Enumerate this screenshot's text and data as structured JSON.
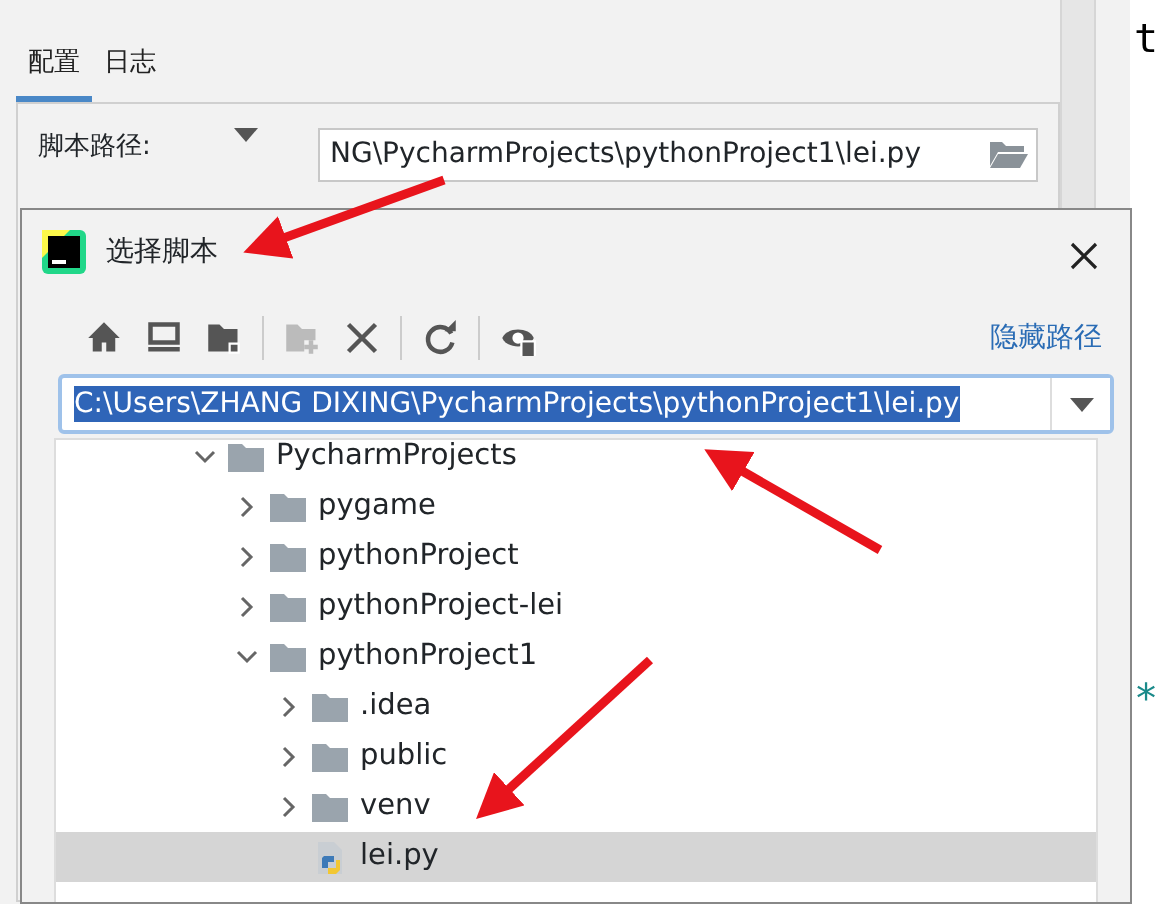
{
  "tabs": [
    {
      "label": "配置",
      "selected": true
    },
    {
      "label": "日志",
      "selected": false
    }
  ],
  "script_path": {
    "label": "脚本路径:",
    "value": "NG\\PycharmProjects\\pythonProject1\\lei.py"
  },
  "editor_fragments": [
    "t",
    "*"
  ],
  "dialog": {
    "title": "选择脚本",
    "toolbar": [
      {
        "kind": "home",
        "disabled": false
      },
      {
        "kind": "desktop",
        "disabled": false
      },
      {
        "kind": "project",
        "disabled": false
      },
      {
        "kind": "new-folder",
        "disabled": true
      },
      {
        "kind": "delete",
        "disabled": false
      },
      {
        "kind": "refresh",
        "disabled": false
      },
      {
        "kind": "hidden",
        "disabled": false
      }
    ],
    "hide_path_link": "隐藏路径",
    "path": "C:\\Users\\ZHANG DIXING\\PycharmProjects\\pythonProject1\\lei.py",
    "tree": [
      {
        "label": "PycharmProjects",
        "kind": "folder",
        "expanded": true,
        "selected": false,
        "children": [
          {
            "label": "pygame",
            "kind": "folder",
            "expanded": false,
            "selected": false
          },
          {
            "label": "pythonProject",
            "kind": "folder",
            "expanded": false,
            "selected": false
          },
          {
            "label": "pythonProject-lei",
            "kind": "folder",
            "expanded": false,
            "selected": false
          },
          {
            "label": "pythonProject1",
            "kind": "folder",
            "expanded": true,
            "selected": false,
            "children": [
              {
                "label": ".idea",
                "kind": "folder",
                "expanded": false,
                "selected": false
              },
              {
                "label": "public",
                "kind": "folder",
                "expanded": false,
                "selected": false
              },
              {
                "label": "venv",
                "kind": "folder",
                "expanded": false,
                "selected": false
              },
              {
                "label": "lei.py",
                "kind": "file",
                "selected": true
              }
            ]
          }
        ]
      }
    ]
  }
}
